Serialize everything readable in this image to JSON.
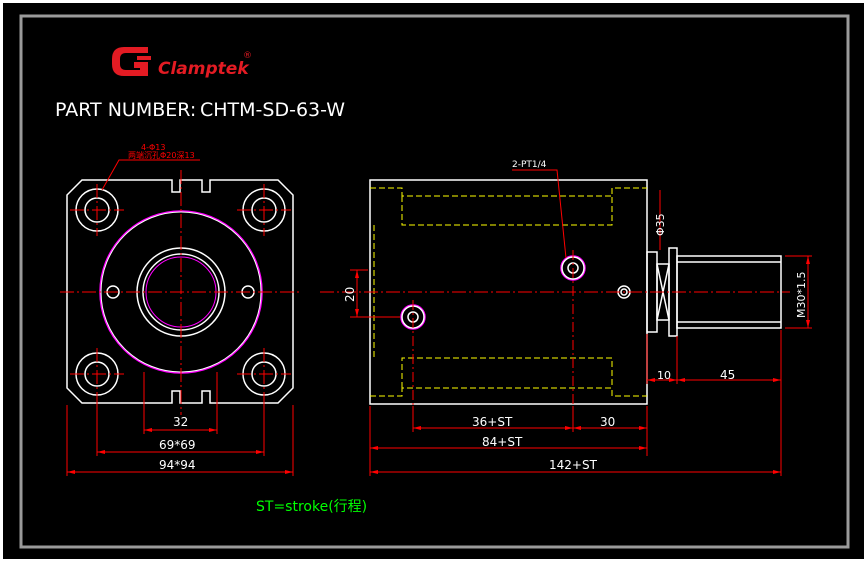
{
  "brand": {
    "name": "Clamptek",
    "registered": "®",
    "logo_color": "#e31b23"
  },
  "part_number": {
    "label": "PART NUMBER:",
    "value": "CHTM-SD-63-W"
  },
  "left_view": {
    "hole_note_1": "4-Φ13",
    "hole_note_2": "两端沉孔Φ20深13",
    "dim_inner": "32",
    "dim_mid": "69*69",
    "dim_outer": "94*94"
  },
  "right_view": {
    "port_note": "2-PT1/4",
    "dim_rod_dia": "Φ35",
    "dim_height": "20",
    "dim_thread": "M30*1.5",
    "dim_10": "10",
    "dim_45": "45",
    "dim_36st": "36+ST",
    "dim_30": "30",
    "dim_84st": "84+ST",
    "dim_142st": "142+ST"
  },
  "stroke_note": "ST=stroke(行程)",
  "colors": {
    "background": "#000000",
    "outline": "#ffffff",
    "dimension": "#ff0000",
    "hidden": "#ffff00",
    "magenta": "#ff00ff",
    "note_green": "#00ff00",
    "frame_border": "#9a9a9a"
  }
}
